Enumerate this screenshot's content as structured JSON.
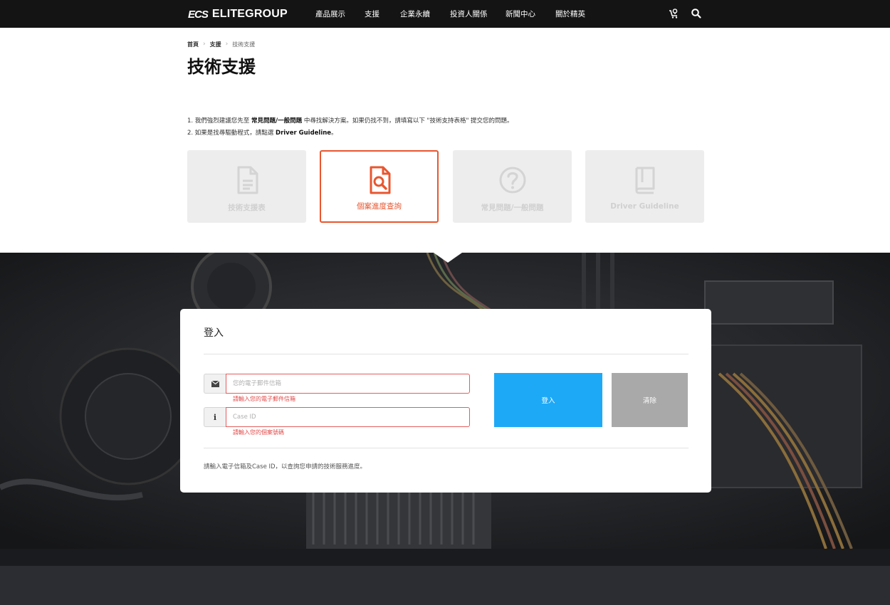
{
  "brand": {
    "mark": "ECS",
    "name": "ELITEGROUP"
  },
  "nav": {
    "items": [
      "產品展示",
      "支援",
      "企業永續",
      "投資人關係",
      "新聞中心",
      "關於精英"
    ],
    "cart_icon": "cart-icon",
    "search_icon": "search-icon"
  },
  "breadcrumb": {
    "home": "首頁",
    "support": "支援",
    "current": "技術支援"
  },
  "page_title": "技術支援",
  "notes": {
    "line1_a": "1. 我們強烈建議您先至 ",
    "line1_bold": "常見問題/一般問題",
    "line1_b": " 中尋找解決方案。如果仍找不到，請填寫以下 \"技術支持表格\" 提交您的問題。",
    "line2_a": "2. 如果是找尋驅動程式，請點選 ",
    "line2_bold": "Driver Guideline",
    "line2_b": "。"
  },
  "cards": [
    {
      "label": "技術支援表",
      "icon": "document-icon",
      "active": false
    },
    {
      "label": "個案進度查詢",
      "icon": "document-search-icon",
      "active": true
    },
    {
      "label": "常見問題/一般問題",
      "icon": "question-icon",
      "active": false
    },
    {
      "label": "Driver Guideline",
      "icon": "book-icon",
      "active": false
    }
  ],
  "login": {
    "title": "登入",
    "email_placeholder": "您的電子郵件信箱",
    "email_error": "請輸入您的電子郵件信箱",
    "case_placeholder": "Case ID",
    "case_error": "請輸入您的個案號碼",
    "login_button": "登入",
    "clear_button": "清除",
    "hint": "請輸入電子信箱及Case ID，以查詢您申請的技術服務進度。"
  },
  "colors": {
    "accent": "#e8562f",
    "primary_button": "#1ea9f7",
    "error": "#e34a4a",
    "nav_bg": "#141414"
  }
}
